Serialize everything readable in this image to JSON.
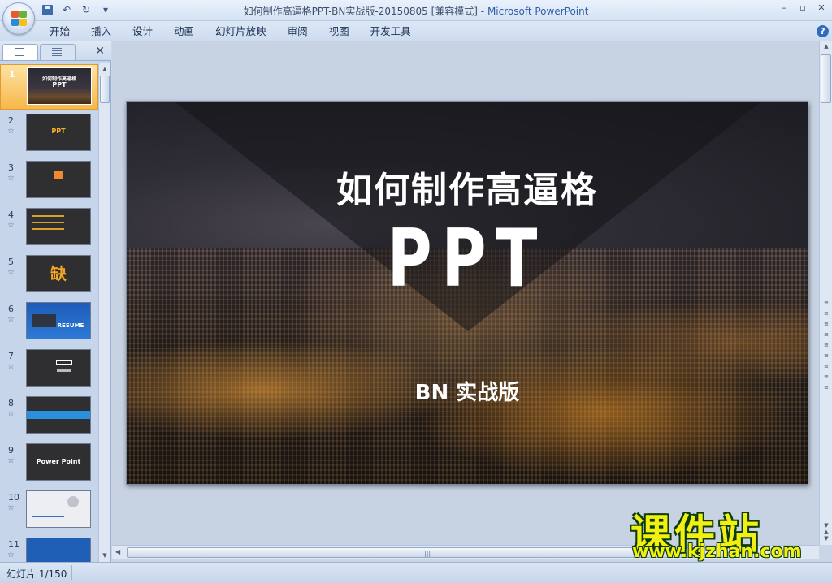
{
  "window": {
    "title": "如何制作高逼格PPT-BN实战版-20150805 [兼容模式]",
    "separator": " - ",
    "app_name": "Microsoft PowerPoint",
    "controls": [
      "–",
      "▫",
      "✕"
    ]
  },
  "qat": {
    "undo_icon": "↶",
    "redo_icon": "↻",
    "customize_icon": "▾"
  },
  "ribbon": {
    "tabs": [
      "开始",
      "插入",
      "设计",
      "动画",
      "幻灯片放映",
      "审阅",
      "视图",
      "开发工具"
    ],
    "help_icon": "?"
  },
  "panel": {
    "close_icon": "✕"
  },
  "thumbnails": [
    {
      "num": "1",
      "star": "",
      "text": "PPT",
      "style": "city",
      "selected": true
    },
    {
      "num": "2",
      "star": "☆",
      "text": "PPT",
      "style": "dark"
    },
    {
      "num": "3",
      "star": "☆",
      "text": "",
      "style": "dark"
    },
    {
      "num": "4",
      "star": "☆",
      "text": "",
      "style": "dark"
    },
    {
      "num": "5",
      "star": "☆",
      "text": "缺",
      "style": "dark"
    },
    {
      "num": "6",
      "star": "☆",
      "text": "RESUME",
      "style": "blue"
    },
    {
      "num": "7",
      "star": "☆",
      "text": "",
      "style": "dark"
    },
    {
      "num": "8",
      "star": "☆",
      "text": "",
      "style": "dark"
    },
    {
      "num": "9",
      "star": "☆",
      "text": "Power Point",
      "style": "dark"
    },
    {
      "num": "10",
      "star": "☆",
      "text": "",
      "style": "light"
    },
    {
      "num": "11",
      "star": "☆",
      "text": "",
      "style": "bluedeep"
    }
  ],
  "slide": {
    "title": "如何制作高逼格",
    "big_text": "PPT",
    "subtitle": "BN 实战版"
  },
  "status": {
    "slide_indicator": "幻灯片 1/150"
  },
  "watermark": {
    "cn": "课件站",
    "url": "www.kjzhan.com"
  },
  "colors": {
    "accent_selected": "#f7b74a",
    "app_title_blue": "#2f5fa7",
    "watermark_yellow": "#f2ef12"
  }
}
